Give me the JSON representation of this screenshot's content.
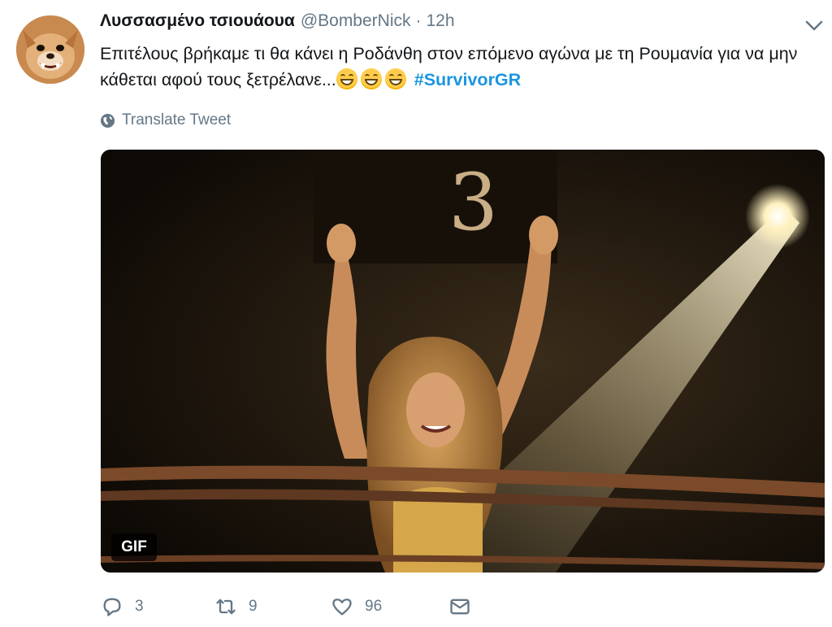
{
  "author": {
    "display_name": "Λυσσασμένο τσιουάουα",
    "handle": "@BomberNick",
    "separator": "·",
    "time": "12h",
    "avatar_icon": "chihuahua-avatar"
  },
  "tweet": {
    "text_part1": "Επιτέλους βρήκαμε τι θα κάνει η Ροδάνθη στον επόμενο αγώνα με τη Ρουμανία για να μην κάθεται αφού τους ξετρέλανε...",
    "emoji_count": 3,
    "emoji_name": "grinning-face-with-smiling-eyes",
    "hashtag": "#SurvivorGR"
  },
  "translate": {
    "label": "Translate Tweet",
    "icon": "globe-icon"
  },
  "media": {
    "badge": "GIF",
    "sign_number": "3",
    "colors": {
      "background": "#0d0905",
      "spotlight": "#fff6d8",
      "rope": "#7a4a2a"
    }
  },
  "actions": {
    "reply_count": "3",
    "retweet_count": "9",
    "like_count": "96"
  },
  "colors": {
    "accent": "#1b95e0",
    "secondary_text": "#657786",
    "primary_text": "#14171a"
  }
}
